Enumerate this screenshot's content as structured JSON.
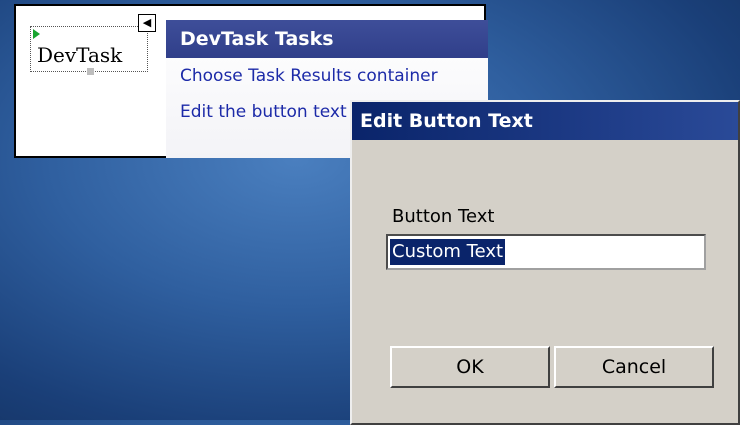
{
  "designer": {
    "control_text": "DevTask",
    "smart_tag_glyph": "◀"
  },
  "tasks_panel": {
    "header": "DevTask Tasks",
    "links": [
      "Choose Task Results container",
      "Edit the button text"
    ]
  },
  "dialog": {
    "title": "Edit Button Text",
    "field_label": "Button Text",
    "field_value": "Custom Text",
    "ok_label": "OK",
    "cancel_label": "Cancel"
  }
}
